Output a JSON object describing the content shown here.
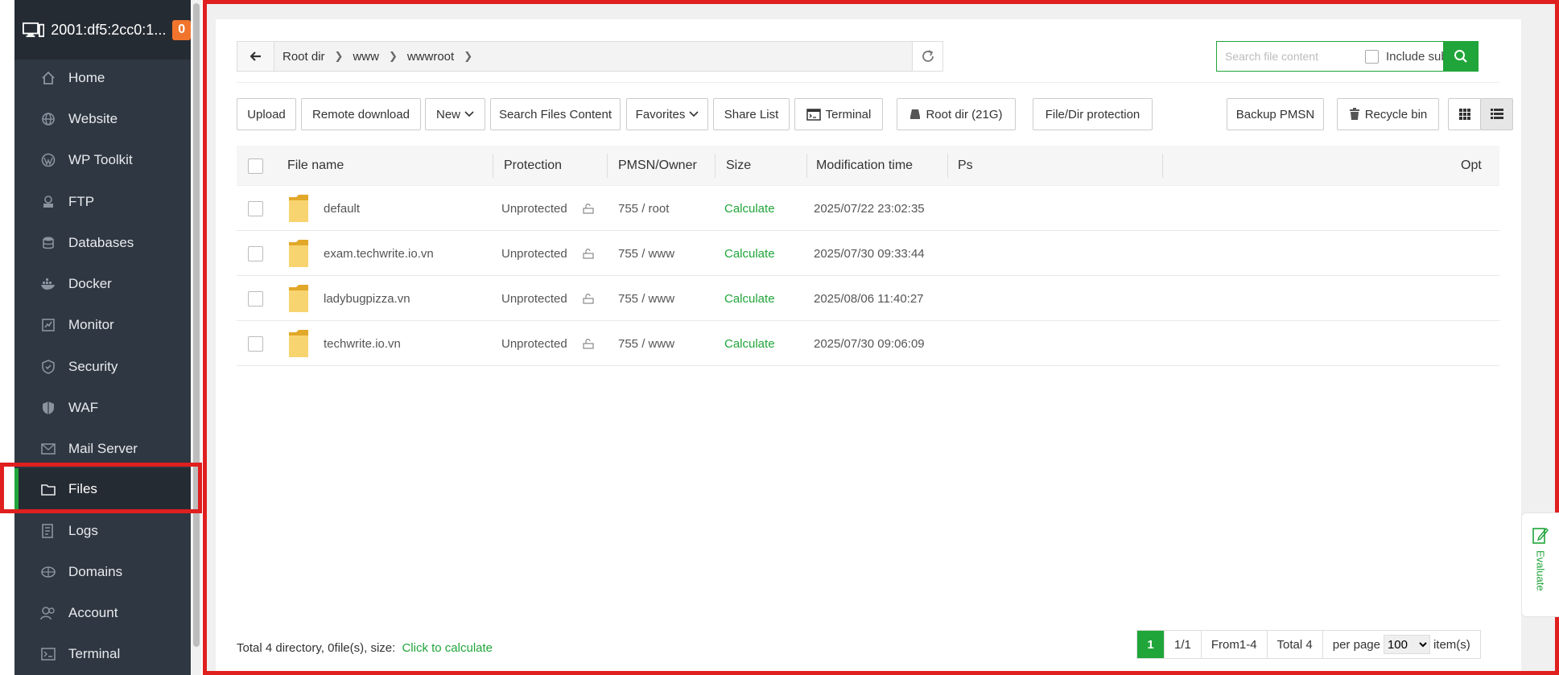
{
  "server": {
    "name": "2001:df5:2cc0:1...",
    "badge": "0"
  },
  "sidebar": {
    "items": [
      {
        "label": "Home",
        "icon": "home-icon"
      },
      {
        "label": "Website",
        "icon": "globe-icon"
      },
      {
        "label": "WP Toolkit",
        "icon": "wordpress-icon"
      },
      {
        "label": "FTP",
        "icon": "ftp-icon"
      },
      {
        "label": "Databases",
        "icon": "database-icon"
      },
      {
        "label": "Docker",
        "icon": "docker-icon"
      },
      {
        "label": "Monitor",
        "icon": "monitor-icon"
      },
      {
        "label": "Security",
        "icon": "shield-icon"
      },
      {
        "label": "WAF",
        "icon": "waf-icon"
      },
      {
        "label": "Mail Server",
        "icon": "mail-icon"
      },
      {
        "label": "Files",
        "icon": "folder-icon",
        "active": true
      },
      {
        "label": "Logs",
        "icon": "logs-icon"
      },
      {
        "label": "Domains",
        "icon": "domains-icon"
      },
      {
        "label": "Account",
        "icon": "account-icon"
      },
      {
        "label": "Terminal",
        "icon": "terminal-icon"
      }
    ]
  },
  "path": {
    "crumbs": [
      "Root dir",
      "www",
      "wwwroot"
    ]
  },
  "search": {
    "placeholder": "Search file content",
    "include_subdir": "Include subdir"
  },
  "toolbar": {
    "upload": "Upload",
    "remote_download": "Remote download",
    "new": "New",
    "search_files_content": "Search Files Content",
    "favorites": "Favorites",
    "share_list": "Share List",
    "terminal": "Terminal",
    "root_dir": "Root dir (21G)",
    "file_dir_protection": "File/Dir protection",
    "backup_pmsn": "Backup PMSN",
    "recycle_bin": "Recycle bin"
  },
  "table": {
    "headers": {
      "name": "File name",
      "protection": "Protection",
      "pmsn": "PMSN/Owner",
      "size": "Size",
      "mtime": "Modification time",
      "ps": "Ps",
      "opt": "Opt"
    },
    "rows": [
      {
        "name": "default",
        "protection": "Unprotected",
        "pmsn": "755 / root",
        "size": "Calculate",
        "mtime": "2025/07/22 23:02:35"
      },
      {
        "name": "exam.techwrite.io.vn",
        "protection": "Unprotected",
        "pmsn": "755 / www",
        "size": "Calculate",
        "mtime": "2025/07/30 09:33:44"
      },
      {
        "name": "ladybugpizza.vn",
        "protection": "Unprotected",
        "pmsn": "755 / www",
        "size": "Calculate",
        "mtime": "2025/08/06 11:40:27"
      },
      {
        "name": "techwrite.io.vn",
        "protection": "Unprotected",
        "pmsn": "755 / www",
        "size": "Calculate",
        "mtime": "2025/07/30 09:06:09"
      }
    ]
  },
  "footer": {
    "summary": "Total 4 directory, 0file(s), size:",
    "calc_link": "Click to calculate"
  },
  "pager": {
    "current": "1",
    "pages": "1/1",
    "range": "From1-4",
    "total": "Total 4",
    "per_page": "per page",
    "per_page_value": "100",
    "items": "item(s)"
  },
  "evaluate": {
    "label": "Evaluate"
  },
  "colors": {
    "accent": "#20a53a",
    "sidebar": "#2f3742",
    "highlight": "#e01f1f",
    "badge": "#f0742c"
  }
}
